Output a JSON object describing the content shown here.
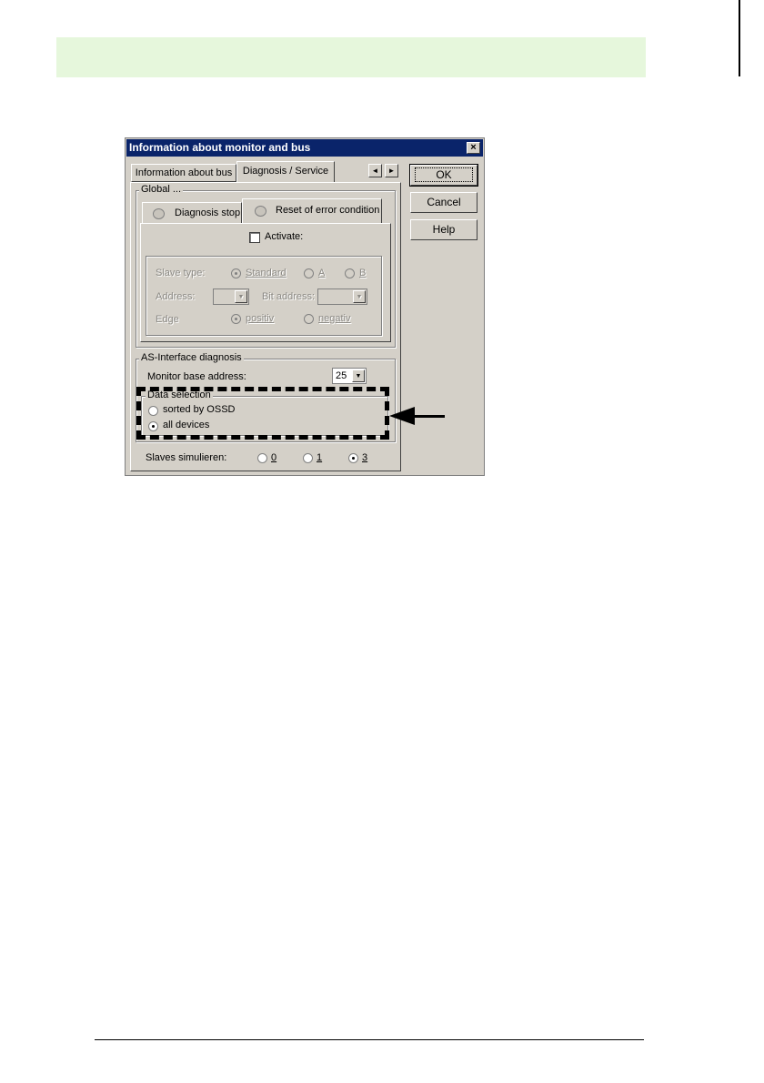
{
  "dialog": {
    "title": "Information about monitor and bus",
    "close_glyph": "×",
    "tabs": [
      {
        "label": "Information about bus"
      },
      {
        "label": "Diagnosis / Service"
      }
    ],
    "tab_scroll": {
      "left": "◄",
      "right": "►"
    },
    "buttons": {
      "ok": "OK",
      "cancel": "Cancel",
      "help": "Help"
    },
    "global": {
      "label": "Global ...",
      "subtabs": [
        {
          "label": "Diagnosis stop",
          "icon": "disk-icon"
        },
        {
          "label": "Reset of error condition",
          "icon": "disk-icon"
        }
      ],
      "activate_label": "Activate:",
      "activate_checked": false,
      "slave_type_label": "Slave type:",
      "slave_type_options": [
        "Standard",
        "A",
        "B"
      ],
      "slave_type_selected": "Standard",
      "address_label": "Address:",
      "address_value": "",
      "bit_address_label": "Bit address:",
      "bit_address_value": "",
      "edge_label": "Edge",
      "edge_options": [
        "positiv",
        "negativ"
      ],
      "edge_selected": "positiv"
    },
    "as_interface": {
      "label": "AS-Interface diagnosis",
      "monitor_base_address_label": "Monitor base address:",
      "monitor_base_address_value": "25",
      "data_selection": {
        "label": "Data selection",
        "options": [
          "sorted by OSSD",
          "all devices"
        ],
        "selected": "all devices"
      },
      "slaves_label": "Slaves simulieren:",
      "slaves_options": [
        "0",
        "1",
        "3"
      ],
      "slaves_selected": "3"
    }
  }
}
